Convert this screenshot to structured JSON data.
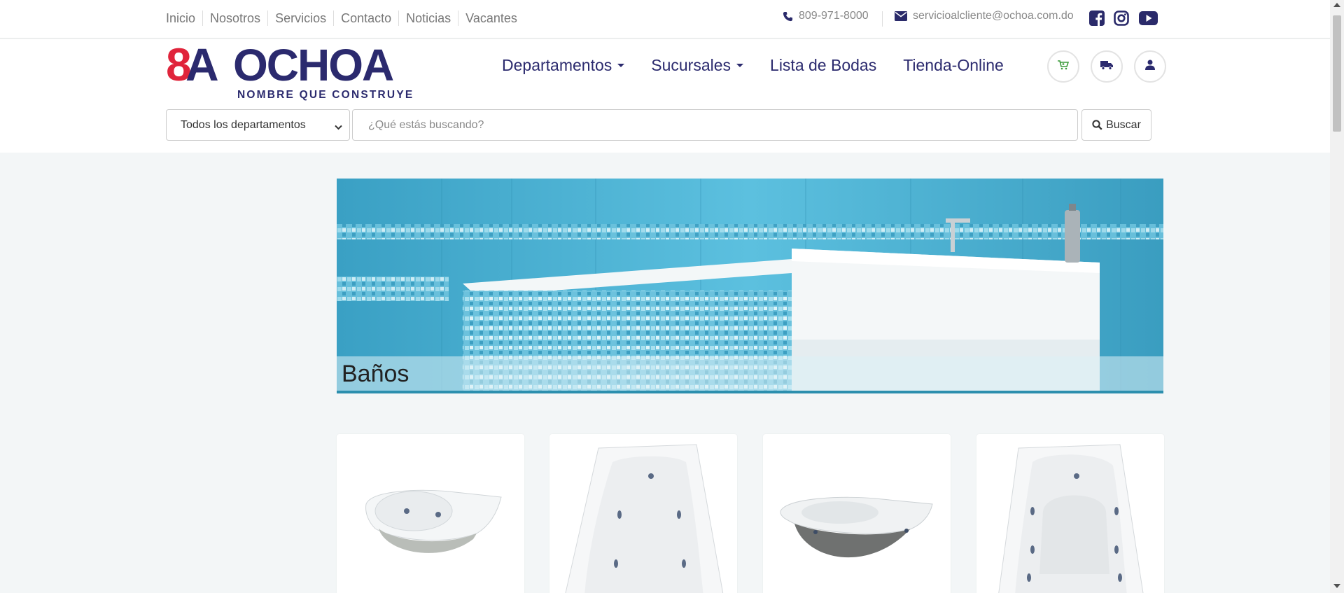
{
  "topbar": {
    "links": [
      "Inicio",
      "Nosotros",
      "Servicios",
      "Contacto",
      "Noticias",
      "Vacantes"
    ],
    "phone": "809-971-8000",
    "email": "servicioalcliente@ochoa.com.do",
    "social_icons": [
      "facebook-icon",
      "instagram-icon",
      "youtube-icon"
    ]
  },
  "brand": {
    "logo_mark": "8A",
    "name": "OCHOA",
    "tagline": "NOMBRE QUE CONSTRUYE",
    "colors": {
      "red": "#e0243b",
      "navy": "#2b2a6e"
    }
  },
  "nav": {
    "departamentos": "Departamentos",
    "sucursales": "Sucursales",
    "lista_bodas": "Lista de Bodas",
    "tienda_online": "Tienda-Online"
  },
  "header_icons": [
    "cart-icon",
    "truck-icon",
    "user-icon"
  ],
  "search": {
    "department_selected": "Todos los departamentos",
    "placeholder": "¿Qué estás buscando?",
    "button_label": "Buscar"
  },
  "banner": {
    "title": "Baños"
  },
  "products": [
    {
      "image": "corner-jacuzzi-tub"
    },
    {
      "image": "rectangular-jacuzzi-tub"
    },
    {
      "image": "corner-tub-gray-base"
    },
    {
      "image": "rectangular-jacuzzi-tub"
    }
  ]
}
